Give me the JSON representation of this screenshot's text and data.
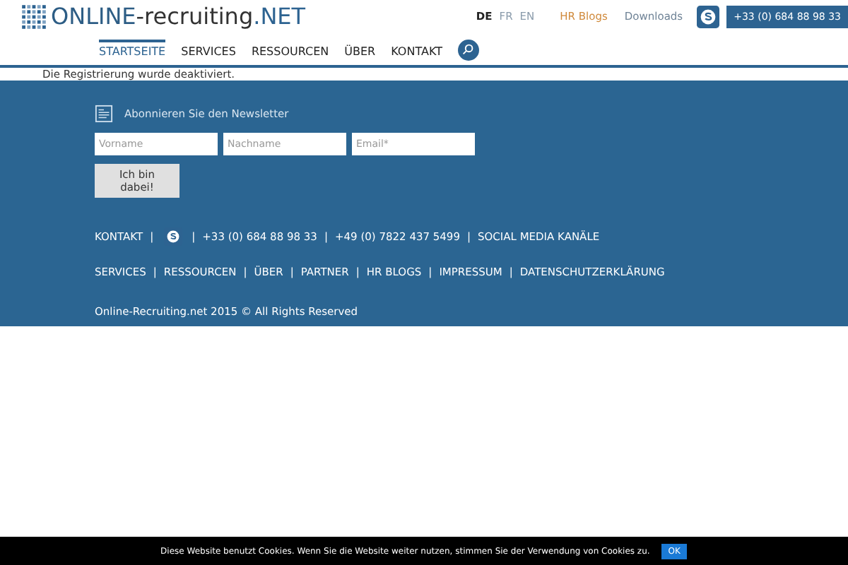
{
  "logo": {
    "part_1": "ONLINE",
    "part_2": "-recruiting",
    "part_3": ".NET"
  },
  "languages": [
    {
      "label": "DE",
      "selected": true
    },
    {
      "label": "FR",
      "selected": false
    },
    {
      "label": "EN",
      "selected": false
    }
  ],
  "top_links": [
    {
      "label": "HR Blogs",
      "kind": "accent"
    },
    {
      "label": "Downloads",
      "kind": "plain"
    }
  ],
  "phone_button": "+33 (0) 684 88 98 33",
  "nav": [
    {
      "label": "STARTSEITE",
      "selected": true
    },
    {
      "label": "SERVICES",
      "selected": false
    },
    {
      "label": "RESSOURCEN",
      "selected": false
    },
    {
      "label": "ÜBER",
      "selected": false
    },
    {
      "label": "KONTAKT",
      "selected": false
    }
  ],
  "notice": "Die Registrierung wurde deaktiviert.",
  "newsletter": {
    "title": "Abonnieren Sie den Newsletter",
    "fields": [
      {
        "placeholder": "Vorname"
      },
      {
        "placeholder": "Nachname"
      },
      {
        "placeholder": "Email*"
      }
    ],
    "button": "Ich bin dabei!"
  },
  "separator": "|",
  "contact_row": [
    {
      "kind": "text",
      "label": "KONTAKT"
    },
    {
      "kind": "skype"
    },
    {
      "kind": "text",
      "label": "+33 (0) 684 88 98 33"
    },
    {
      "kind": "text",
      "label": "+49 (0) 7822 437 5499"
    },
    {
      "kind": "text",
      "label": "SOCIAL MEDIA KANÄLE"
    }
  ],
  "footer_links": [
    "SERVICES",
    "RESSOURCEN",
    "ÜBER",
    "PARTNER",
    "HR BLOGS",
    "IMPRESSUM",
    "DATENSCHUTZERKLÄRUNG"
  ],
  "copyright": "Online-Recruiting.net 2015 © All Rights Reserved",
  "cookie_bar": {
    "text": "Diese Website benutzt Cookies. Wenn Sie die Website weiter nutzen, stimmen Sie der Verwendung von Cookies zu.",
    "button": "OK"
  }
}
